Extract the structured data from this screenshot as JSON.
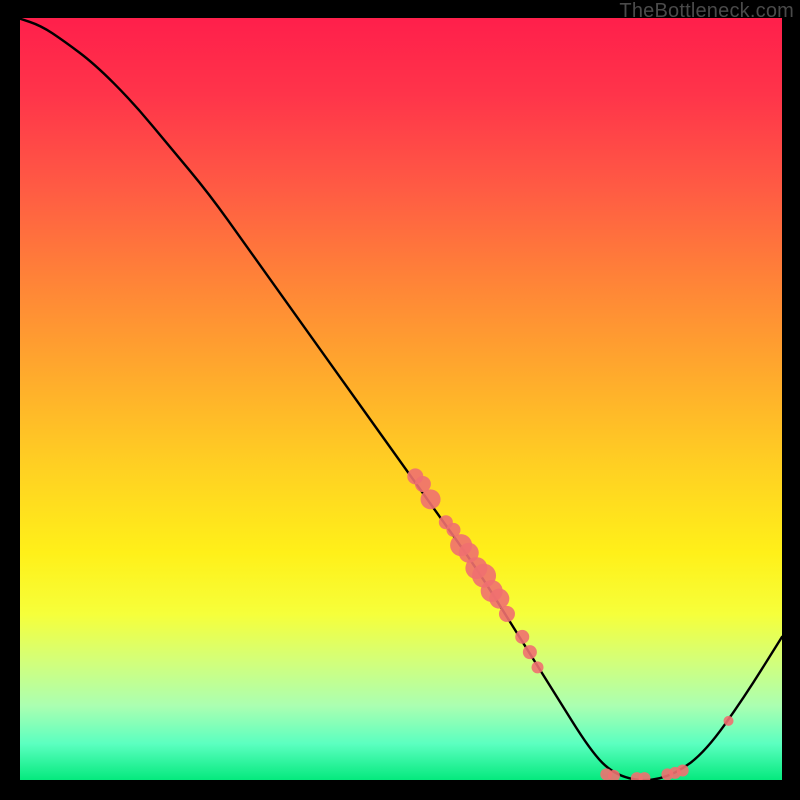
{
  "attribution": "TheBottleneck.com",
  "chart_data": {
    "type": "line",
    "title": "",
    "xlabel": "",
    "ylabel": "",
    "xlim": [
      0,
      100
    ],
    "ylim": [
      0,
      100
    ],
    "grid": false,
    "legend": false,
    "series": [
      {
        "name": "bottleneck-curve",
        "color": "#000000",
        "x": [
          0,
          3,
          6,
          10,
          15,
          20,
          25,
          30,
          35,
          40,
          45,
          50,
          55,
          60,
          65,
          70,
          75,
          78,
          82,
          86,
          90,
          95,
          100
        ],
        "y": [
          100,
          99,
          97,
          94,
          89,
          83,
          77,
          70,
          63,
          56,
          49,
          42,
          35,
          28,
          20,
          12,
          4,
          1,
          0,
          1,
          4,
          11,
          19
        ]
      }
    ],
    "markers": [
      {
        "x": 52,
        "y": 40,
        "r": 1.6
      },
      {
        "x": 53,
        "y": 39,
        "r": 1.6
      },
      {
        "x": 54,
        "y": 37,
        "r": 2.0
      },
      {
        "x": 56,
        "y": 34,
        "r": 1.4
      },
      {
        "x": 57,
        "y": 33,
        "r": 1.4
      },
      {
        "x": 58,
        "y": 31,
        "r": 2.2
      },
      {
        "x": 59,
        "y": 30,
        "r": 2.0
      },
      {
        "x": 60,
        "y": 28,
        "r": 2.2
      },
      {
        "x": 61,
        "y": 27,
        "r": 2.4
      },
      {
        "x": 62,
        "y": 25,
        "r": 2.2
      },
      {
        "x": 63,
        "y": 24,
        "r": 2.0
      },
      {
        "x": 64,
        "y": 22,
        "r": 1.6
      },
      {
        "x": 66,
        "y": 19,
        "r": 1.4
      },
      {
        "x": 67,
        "y": 17,
        "r": 1.4
      },
      {
        "x": 68,
        "y": 15,
        "r": 1.2
      },
      {
        "x": 77,
        "y": 1,
        "r": 1.2
      },
      {
        "x": 78,
        "y": 0.8,
        "r": 1.2
      },
      {
        "x": 81,
        "y": 0.5,
        "r": 1.2
      },
      {
        "x": 82,
        "y": 0.5,
        "r": 1.2
      },
      {
        "x": 85,
        "y": 1,
        "r": 1.2
      },
      {
        "x": 86,
        "y": 1.2,
        "r": 1.2
      },
      {
        "x": 87,
        "y": 1.5,
        "r": 1.2
      },
      {
        "x": 93,
        "y": 8,
        "r": 1.0
      }
    ],
    "marker_color": "#ef7070",
    "background_gradient": [
      "#ff1f4b",
      "#ffce23",
      "#fff019",
      "#00e87a"
    ]
  }
}
